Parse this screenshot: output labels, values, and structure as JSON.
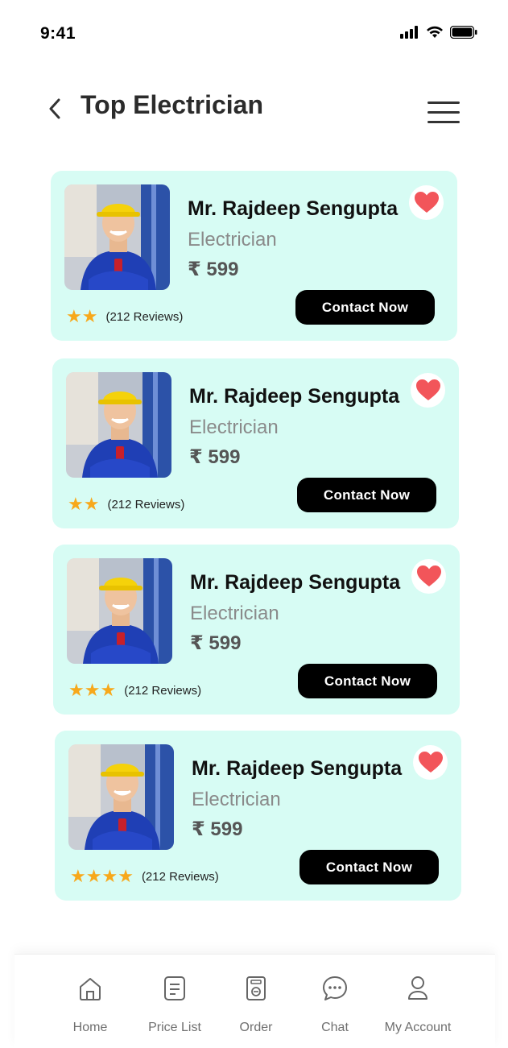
{
  "status_bar": {
    "time": "9:41"
  },
  "header": {
    "title": "Top Electrician"
  },
  "cards": [
    {
      "name": "Mr. Rajdeep Sengupta",
      "profession": "Electrician",
      "price": "₹ 599",
      "stars": 2,
      "reviews": "(212 Reviews)",
      "contact_label": "Contact  Now",
      "favorite": true
    },
    {
      "name": "Mr. Rajdeep Sengupta",
      "profession": "Electrician",
      "price": "₹ 599",
      "stars": 2,
      "reviews": "(212 Reviews)",
      "contact_label": "Contact  Now",
      "favorite": true
    },
    {
      "name": "Mr. Rajdeep Sengupta",
      "profession": "Electrician",
      "price": "₹ 599",
      "stars": 3,
      "reviews": "(212 Reviews)",
      "contact_label": "Contact  Now",
      "favorite": true
    },
    {
      "name": "Mr. Rajdeep Sengupta",
      "profession": "Electrician",
      "price": "₹ 599",
      "stars": 4,
      "reviews": "(212 Reviews)",
      "contact_label": "Contact  Now",
      "favorite": true
    }
  ],
  "bottom_nav": [
    {
      "label": "Home",
      "icon": "home-icon"
    },
    {
      "label": "Price List",
      "icon": "price-list-icon"
    },
    {
      "label": "Order",
      "icon": "order-icon"
    },
    {
      "label": "Chat",
      "icon": "chat-icon"
    },
    {
      "label": "My Account",
      "icon": "account-icon"
    }
  ],
  "colors": {
    "card_bg": "#d7fcf4",
    "star": "#f7a81b",
    "heart": "#f2555a",
    "button_bg": "#000000"
  }
}
